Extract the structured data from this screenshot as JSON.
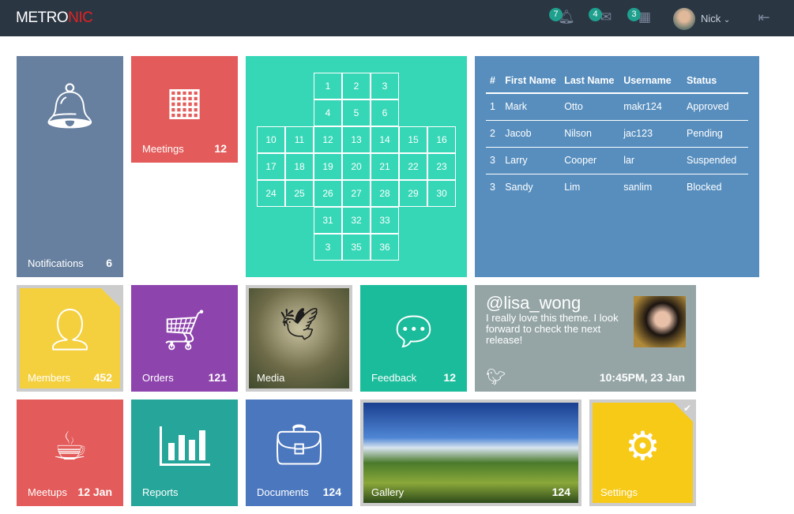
{
  "header": {
    "logo_a": "METRO",
    "logo_b": "NIC",
    "notifications": "7",
    "messages": "4",
    "tasks": "3",
    "user": "Nick"
  },
  "tiles": {
    "notifications": {
      "label": "Notifications",
      "count": "6"
    },
    "meetings": {
      "label": "Meetings",
      "count": "12"
    },
    "members": {
      "label": "Members",
      "count": "452"
    },
    "orders": {
      "label": "Orders",
      "count": "121"
    },
    "media": {
      "label": "Media"
    },
    "feedback": {
      "label": "Feedback",
      "count": "12"
    },
    "meetups": {
      "label": "Meetups",
      "count": "12 Jan"
    },
    "reports": {
      "label": "Reports"
    },
    "documents": {
      "label": "Documents",
      "count": "124"
    },
    "gallery": {
      "label": "Gallery",
      "count": "124"
    },
    "settings": {
      "label": "Settings"
    }
  },
  "calendar": {
    "rows": [
      [
        "1",
        "2",
        "3"
      ],
      [
        "4",
        "5",
        "6"
      ],
      [
        "10",
        "11",
        "12",
        "13",
        "14",
        "15",
        "16"
      ],
      [
        "17",
        "18",
        "19",
        "20",
        "21",
        "22",
        "23"
      ],
      [
        "24",
        "25",
        "26",
        "27",
        "28",
        "29",
        "30"
      ],
      [
        "31",
        "32",
        "33"
      ],
      [
        "3",
        "35",
        "36"
      ]
    ]
  },
  "table": {
    "headers": [
      "#",
      "First Name",
      "Last Name",
      "Username",
      "Status"
    ],
    "rows": [
      [
        "1",
        "Mark",
        "Otto",
        "makr124",
        "Approved"
      ],
      [
        "2",
        "Jacob",
        "Nilson",
        "jac123",
        "Pending"
      ],
      [
        "3",
        "Larry",
        "Cooper",
        "lar",
        "Suspended"
      ],
      [
        "3",
        "Sandy",
        "Lim",
        "sanlim",
        "Blocked"
      ]
    ]
  },
  "tweet": {
    "handle": "@lisa_wong",
    "text": "I really love this theme. I look forward to check the next release!",
    "time": "10:45PM, 23 Jan"
  },
  "colors": {
    "header": "#2b3643",
    "notifications": "#67809f",
    "meetings": "#e35b5a",
    "calendar": "#36d7b7",
    "table": "#578ebe",
    "members": "#f4d03f",
    "orders": "#8e44ad",
    "feedback": "#1bbc9b",
    "tweet": "#95a5a6",
    "meetups": "#e35b5a",
    "reports": "#26a69a",
    "documents": "#4b77be",
    "settings": "#f7ca18"
  }
}
